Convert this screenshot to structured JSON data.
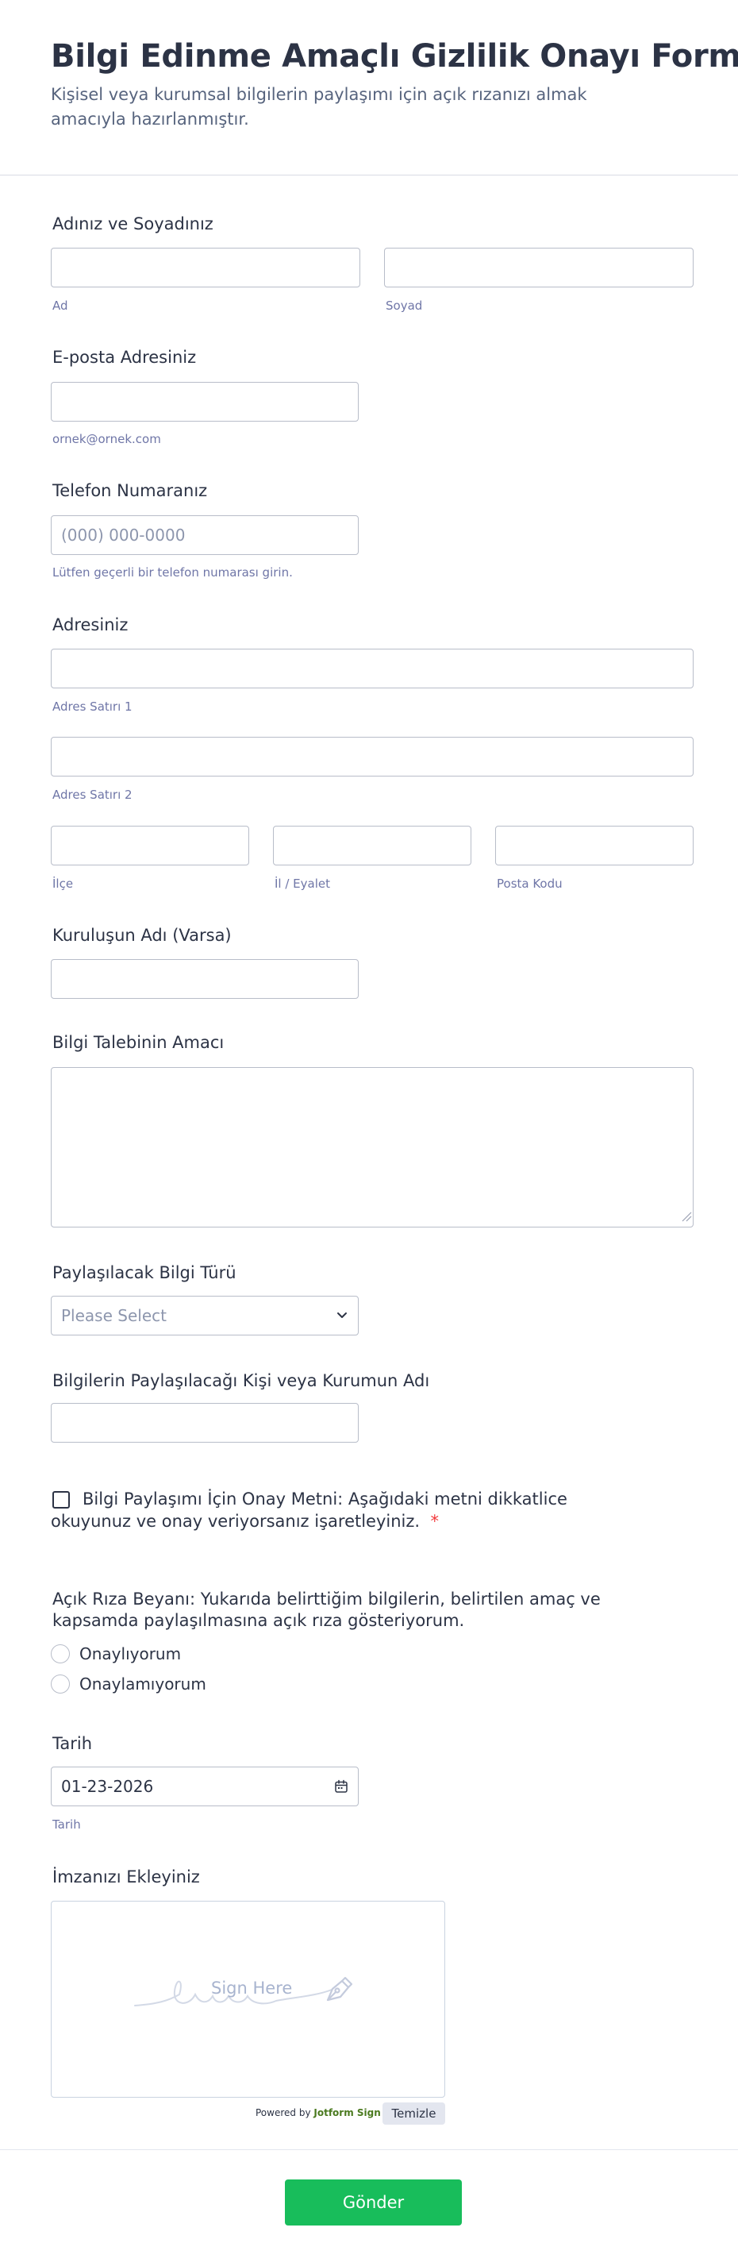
{
  "header": {
    "title": "Bilgi Edinme Amaçlı Gizlilik Onayı Formu",
    "subtitle": "Kişisel veya kurumsal bilgilerin paylaşımı için açık rızanızı almak amacıyla hazırlanmıştır."
  },
  "name": {
    "label": "Adınız ve Soyadınız",
    "first_sublabel": "Ad",
    "last_sublabel": "Soyad",
    "first_value": "",
    "last_value": ""
  },
  "email": {
    "label": "E-posta Adresiniz",
    "sublabel": "ornek@ornek.com",
    "value": ""
  },
  "phone": {
    "label": "Telefon Numaranız",
    "placeholder": "(000) 000-0000",
    "sublabel": "Lütfen geçerli bir telefon numarası girin.",
    "value": ""
  },
  "address": {
    "label": "Adresiniz",
    "line1_sublabel": "Adres Satırı 1",
    "line2_sublabel": "Adres Satırı 2",
    "district_sublabel": "İlçe",
    "city_sublabel": "İl / Eyalet",
    "postal_sublabel": "Posta Kodu"
  },
  "organization": {
    "label": "Kuruluşun Adı (Varsa)",
    "value": ""
  },
  "purpose": {
    "label": "Bilgi Talebinin Amacı",
    "value": ""
  },
  "info_type": {
    "label": "Paylaşılacak Bilgi Türü",
    "selected": "Please Select",
    "chevron_icon": "chevron-down-icon"
  },
  "recipient": {
    "label": "Bilgilerin Paylaşılacağı Kişi veya Kurumun Adı",
    "value": ""
  },
  "consent_checkbox": {
    "text": "Bilgi Paylaşımı İçin Onay Metni: Aşağıdaki metni dikkatlice okuyunuz ve onay veriyorsanız işaretleyiniz.",
    "required_mark": "*",
    "checked": false
  },
  "explicit_consent": {
    "question": "Açık Rıza Beyanı: Yukarıda belirttiğim bilgilerin, belirtilen amaç ve kapsamda paylaşılmasına açık rıza gösteriyorum.",
    "options": [
      "Onaylıyorum",
      "Onaylamıyorum"
    ],
    "selected": null
  },
  "date": {
    "label": "Tarih",
    "value": "01-23-2026",
    "sublabel": "Tarih",
    "icon": "calendar-icon"
  },
  "signature": {
    "label": "İmzanızı Ekleyiniz",
    "placeholder": "Sign Here",
    "powered_prefix": "Powered by",
    "powered_brand": "Jotform Sign",
    "clear_label": "Temizle",
    "icon": "pen-nib-icon"
  },
  "submit": {
    "label": "Gönder",
    "color": "#18bd5b"
  }
}
